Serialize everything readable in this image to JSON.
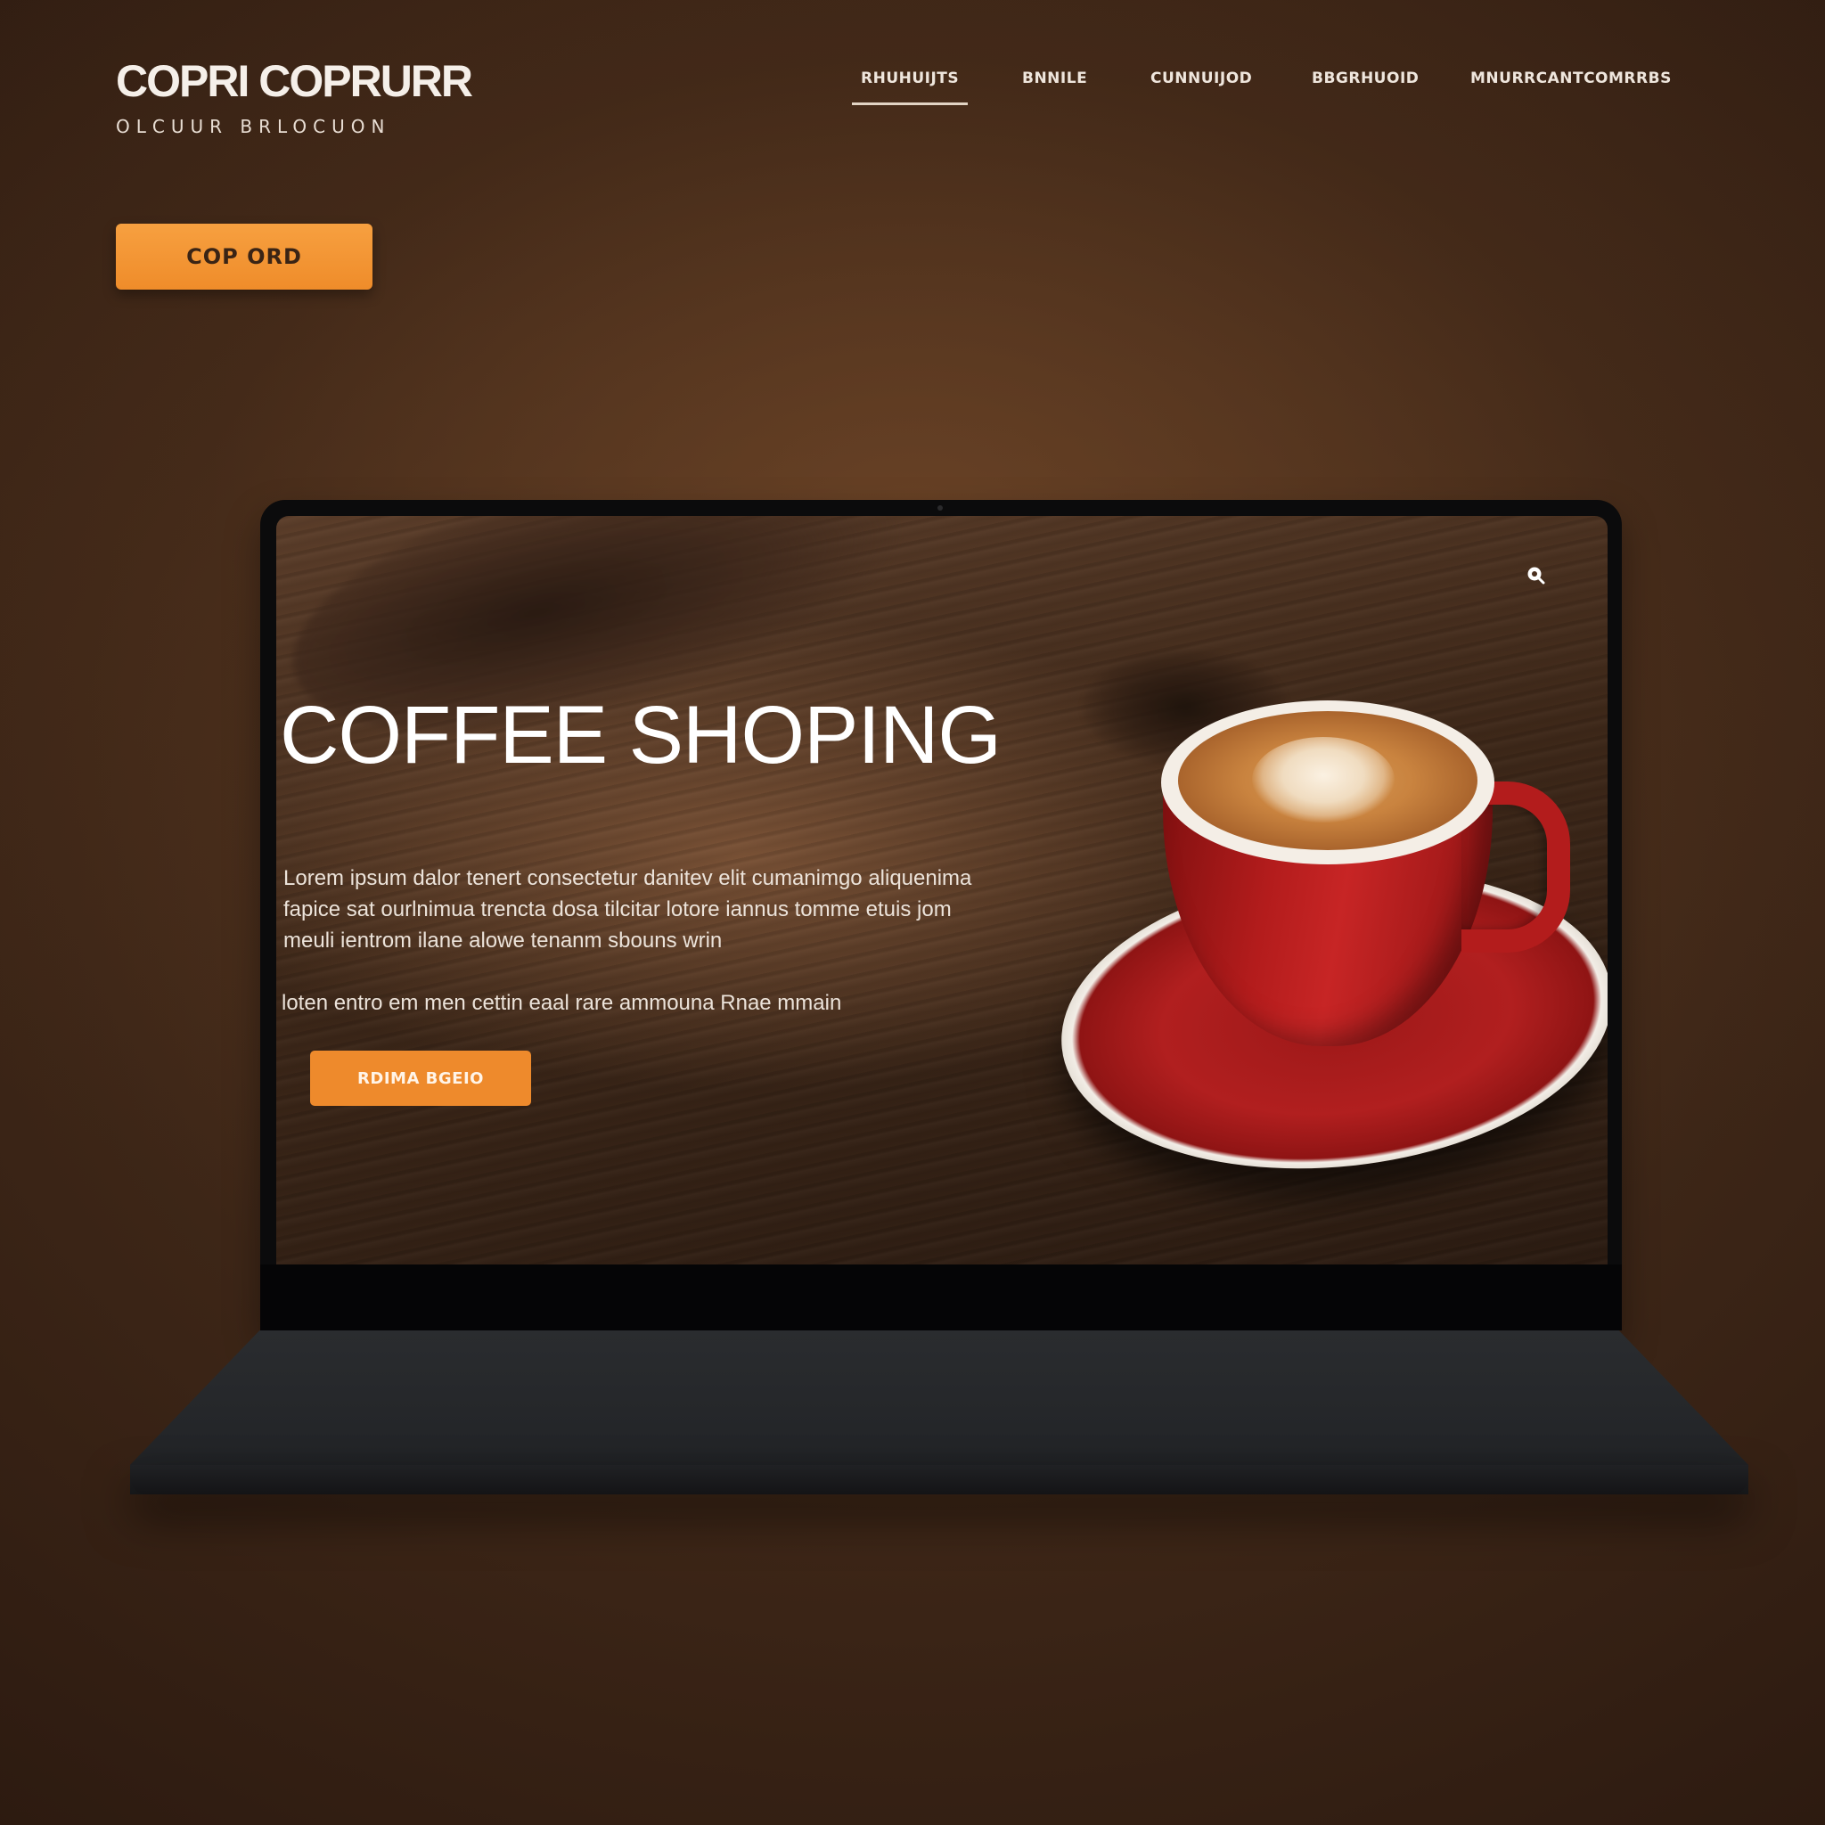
{
  "brand": {
    "name": "COPRI COPRURR",
    "tagline": "OLCUUR BRLOCUON"
  },
  "nav": {
    "items": [
      {
        "label": "RHUHUIJTS",
        "active": true
      },
      {
        "label": "BNNILE",
        "active": false
      },
      {
        "label": "CUNNUIJOD",
        "active": false
      },
      {
        "label": "BBGRHUOID",
        "active": false
      },
      {
        "label": "MNURRCANTCOMRRBS",
        "active": false
      }
    ]
  },
  "header_cta": {
    "label": "COP ORD"
  },
  "hero": {
    "title": "COFFEE SHOPING",
    "paragraph": "Lorem ipsum dalor tenert consectetur danitev elit cumanimgo aliquenima fapice sat ourlnimua trencta dosa tilcitar lotore iannus tomme etuis jom meuli ientrom ilane alowe tenanm sbouns wrin",
    "line2": "loten entro em men cettin eaal rare ammouna Rnae mmain",
    "cta_label": "RDIMA BGEIO"
  },
  "icons": {
    "search": "search-icon"
  },
  "colors": {
    "accent": "#ef8c2a",
    "background": "#3d2617",
    "cup": "#b31c1c"
  }
}
